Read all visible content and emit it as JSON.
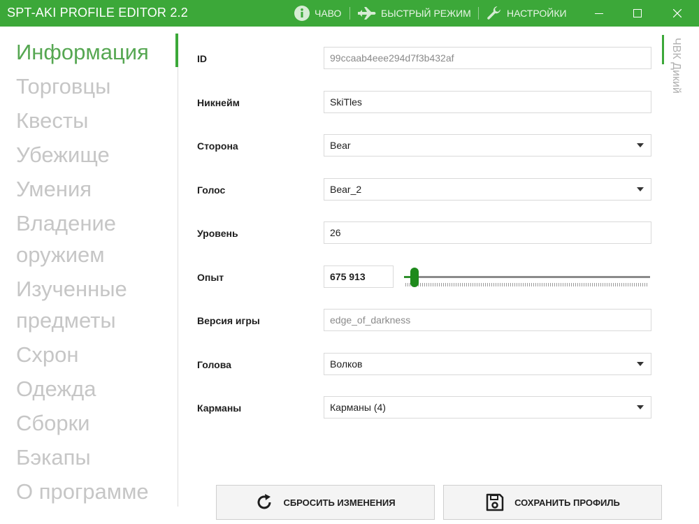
{
  "app": {
    "title": "SPT-AKI PROFILE EDITOR  2.2",
    "accent_color": "#3ca839"
  },
  "titlebar": {
    "faq": {
      "label": "ЧАВО",
      "icon": "info-icon"
    },
    "fast_mode": {
      "label": "БЫСТРЫЙ РЕЖИМ",
      "icon": "airplane-icon"
    },
    "settings": {
      "label": "НАСТРОЙКИ",
      "icon": "wrench-icon"
    },
    "window_controls": [
      "minimize-icon",
      "maximize-icon",
      "close-icon"
    ]
  },
  "sidebar": {
    "active_index": 0,
    "items": [
      {
        "label": "Информация"
      },
      {
        "label": "Торговцы"
      },
      {
        "label": "Квесты"
      },
      {
        "label": "Убежище"
      },
      {
        "label": "Умения"
      },
      {
        "label_line1": "Владение",
        "label_line2": "оружием"
      },
      {
        "label_line1": "Изученные",
        "label_line2": "предметы"
      },
      {
        "label": "Схрон"
      },
      {
        "label": "Одежда"
      },
      {
        "label": "Сборки"
      },
      {
        "label": "Бэкапы"
      },
      {
        "label": "О программе"
      }
    ]
  },
  "side_tab": {
    "label": "ЧВК Дикий"
  },
  "form": {
    "id": {
      "label": "ID",
      "value": "99ccaab4eee294d7f3b432af"
    },
    "nickname": {
      "label": "Никнейм",
      "value": "SkiTles"
    },
    "side": {
      "label": "Сторона",
      "value": "Bear"
    },
    "voice": {
      "label": "Голос",
      "value": "Bear_2"
    },
    "level": {
      "label": "Уровень",
      "value": "26"
    },
    "experience": {
      "label": "Опыт",
      "value": "675 913",
      "slider_fraction": 0.02
    },
    "game_version": {
      "label": "Версия игры",
      "value": "edge_of_darkness"
    },
    "head": {
      "label": "Голова",
      "value": "Волков"
    },
    "pockets": {
      "label": "Карманы",
      "value": "Карманы (4)"
    }
  },
  "actions": {
    "reset": {
      "label": "СБРОСИТЬ ИЗМЕНЕНИЯ",
      "icon": "refresh-icon"
    },
    "save": {
      "label": "СОХРАНИТЬ ПРОФИЛЬ",
      "icon": "save-icon"
    }
  }
}
